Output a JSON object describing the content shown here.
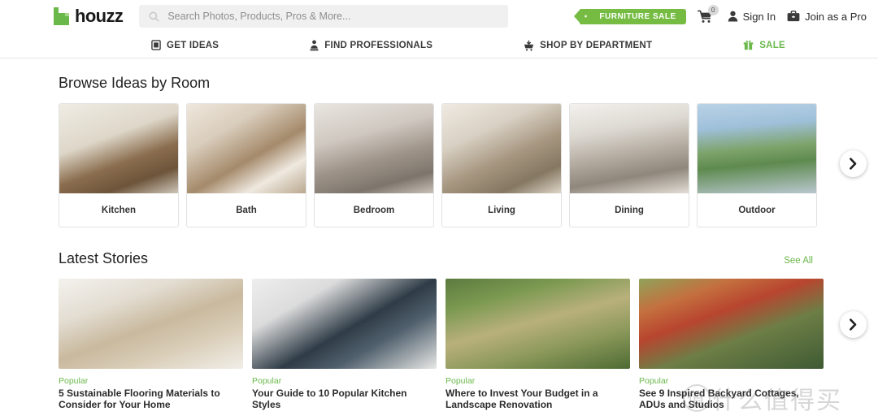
{
  "header": {
    "logo_text": "houzz",
    "search": {
      "placeholder": "Search Photos, Products, Pros & More...",
      "value": "",
      "icon": "search-icon"
    },
    "sale_tag": "FURNITURE SALE",
    "cart": {
      "icon": "cart-icon",
      "badge_count": "0"
    },
    "sign_in": {
      "label": "Sign In",
      "icon": "user-icon"
    },
    "join_pro": {
      "label": "Join as a Pro",
      "icon": "briefcase-icon"
    }
  },
  "nav": {
    "items": [
      {
        "label": "GET IDEAS",
        "icon": "camera-icon",
        "accent": false
      },
      {
        "label": "FIND PROFESSIONALS",
        "icon": "person-icon",
        "accent": false
      },
      {
        "label": "SHOP BY DEPARTMENT",
        "icon": "cart-icon",
        "accent": false
      },
      {
        "label": "SALE",
        "icon": "gift-icon",
        "accent": true
      }
    ]
  },
  "rooms_section": {
    "title": "Browse Ideas by Room",
    "next_button_icon": "chevron-right-icon",
    "cards": [
      {
        "label": "Kitchen",
        "img": "img-kitchen"
      },
      {
        "label": "Bath",
        "img": "img-bath"
      },
      {
        "label": "Bedroom",
        "img": "img-bedroom"
      },
      {
        "label": "Living",
        "img": "img-living"
      },
      {
        "label": "Dining",
        "img": "img-dining"
      },
      {
        "label": "Outdoor",
        "img": "img-outdoor"
      }
    ]
  },
  "stories_section": {
    "title": "Latest Stories",
    "see_all": "See All",
    "next_button_icon": "chevron-right-icon",
    "cards": [
      {
        "tag": "Popular",
        "title": "5 Sustainable Flooring Materials to Consider for Your Home",
        "img": "img-story1"
      },
      {
        "tag": "Popular",
        "title": "Your Guide to 10 Popular Kitchen Styles",
        "img": "img-story2"
      },
      {
        "tag": "Popular",
        "title": "Where to Invest Your Budget in a Landscape Renovation",
        "img": "img-story3"
      },
      {
        "tag": "Popular",
        "title": "See 9 Inspired Backyard Cottages, ADUs and Studios",
        "img": "img-story4"
      }
    ]
  },
  "watermark": {
    "circle_char": "值",
    "text": "什么值得买"
  },
  "colors": {
    "brand_green": "#6ab84a",
    "tag_green": "#76bc43",
    "text_dark": "#2b2b2b",
    "search_bg": "#f0f0f0"
  }
}
